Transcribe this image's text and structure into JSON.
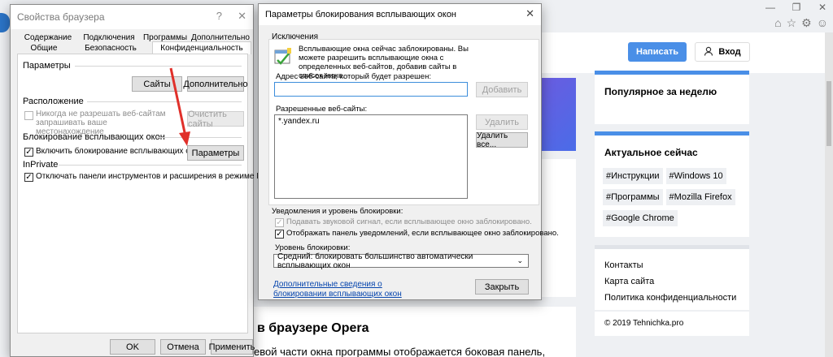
{
  "webpage": {
    "write_button": "Написать",
    "login_button": "Вход",
    "widget_popular": {
      "title": "Популярное за неделю"
    },
    "widget_trending": {
      "title": "Актуальное сейчас",
      "tags": [
        "#Инструкции",
        "#Windows 10",
        "#Программы",
        "#Mozilla Firefox",
        "#Google Chrome"
      ]
    },
    "footer_links": [
      "Контакты",
      "Карта сайта",
      "Политика конфиденциальности"
    ],
    "copyright": "© 2019 Tehnichka.pro",
    "article_title": "в браузере Opera",
    "article_text": "евой части окна программы отображается боковая панель,"
  },
  "left_dialog": {
    "title": "Свойства браузера",
    "help": "?",
    "close": "✕",
    "tabs_row1": [
      "Содержание",
      "Подключения",
      "Программы",
      "Дополнительно"
    ],
    "tabs_row2": [
      "Общие",
      "Безопасность",
      "Конфиденциальность"
    ],
    "params_label": "Параметры",
    "sites_button": "Сайты",
    "advanced_button": "Дополнительно",
    "location_label": "Расположение",
    "location_checkbox": "Никогда не разрешать веб-сайтам запрашивать ваше местонахождение",
    "clear_sites_button": "Очистить сайты",
    "popup_label": "Блокирование всплывающих окон",
    "popup_checkbox": "Включить блокирование всплывающих окон",
    "popup_settings_button": "Параметры",
    "inprivate_label": "InPrivate",
    "inprivate_checkbox": "Отключать панели инструментов и расширения в режиме InPrivate",
    "ok_button": "OK",
    "cancel_button": "Отмена",
    "apply_button": "Применить"
  },
  "right_dialog": {
    "title": "Параметры блокирования всплывающих окон",
    "close": "✕",
    "exceptions_label": "Исключения",
    "exceptions_text": "Всплывающие окна сейчас заблокированы. Вы можете разрешить всплывающие окна с определенных веб-сайтов, добавив сайты в список ниже.",
    "address_label": "Адрес веб-сайта, который будет разрешен:",
    "address_value": "",
    "add_button": "Добавить",
    "allowed_label": "Разрешенные веб-сайты:",
    "allowed_sites": [
      "*.yandex.ru"
    ],
    "remove_button": "Удалить",
    "remove_all_button": "Удалить все...",
    "notifications_label": "Уведомления и уровень блокировки:",
    "sound_checkbox": "Подавать звуковой сигнал, если всплывающее окно заблокировано.",
    "notify_checkbox": "Отображать панель уведомлений, если всплывающее окно заблокировано.",
    "level_label": "Уровень блокировки:",
    "level_value": "Средний: блокировать большинство автоматически всплывающих окон",
    "more_info_link": "Дополнительные сведения о блокировании всплывающих окон",
    "close_button": "Закрыть"
  },
  "colors": {
    "accent": "#4a8fe7",
    "annotation_arrow": "#e0302a"
  }
}
